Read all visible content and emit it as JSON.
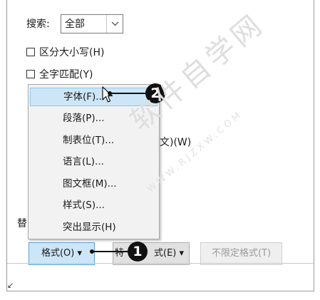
{
  "search": {
    "label": "搜索:",
    "value": "全部",
    "dropdown_icon": "chevron-down-icon"
  },
  "options": [
    {
      "label": "区分大小写(H)",
      "checked": false
    },
    {
      "label": "全字匹配(Y)",
      "checked": false
    }
  ],
  "partial_texts": {
    "wildcard_tail": "文)(W)",
    "replace_fragment": "替"
  },
  "format_menu": {
    "items": [
      {
        "label": "字体(F)..."
      },
      {
        "label": "段落(P)..."
      },
      {
        "label": "制表位(T)..."
      },
      {
        "label": "语言(L)..."
      },
      {
        "label": "图文框(M)..."
      },
      {
        "label": "样式(S)..."
      },
      {
        "label": "突出显示(H)"
      }
    ],
    "highlight_color": "#cde6f7"
  },
  "buttons": {
    "format": "格式(O) ▾",
    "special_fragment": "特",
    "special_tail": "式(E) ▾",
    "no_format": "不限定格式(T)"
  },
  "callouts": {
    "one": "1",
    "two": "2"
  },
  "watermark": {
    "text": "软件自学网",
    "url": "WWW.RJZXW.COM"
  },
  "footer": {
    "mark": "↙"
  }
}
